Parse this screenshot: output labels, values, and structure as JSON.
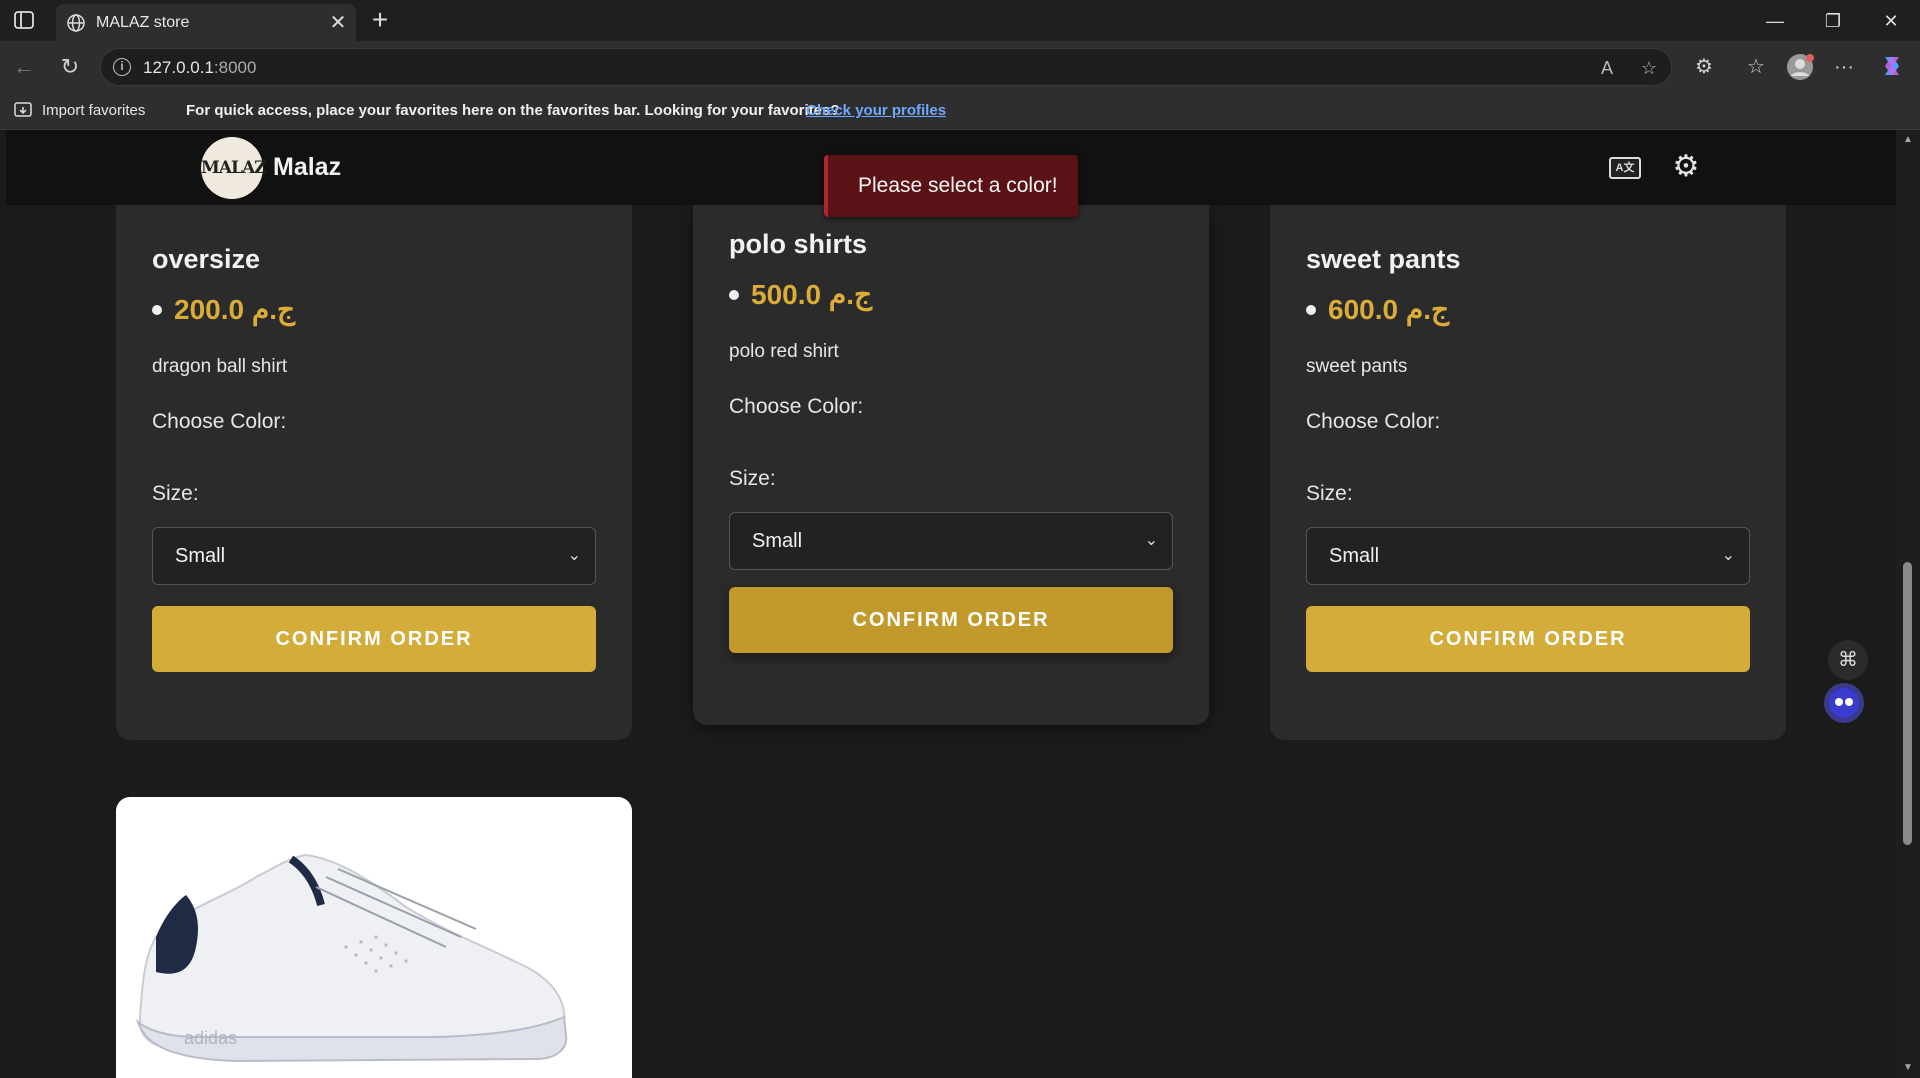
{
  "browser": {
    "tab_title": "MALAZ store",
    "url_host": "127.0.0.1",
    "url_port": ":8000",
    "favorites_import": "Import favorites",
    "favorites_message": "For quick access, place your favorites here on the favorites bar. Looking for your favorites?",
    "favorites_link": "Check your profiles"
  },
  "site": {
    "brand": "Malaz",
    "logo_text": "MALAZ",
    "toast": "Please select a color!"
  },
  "products": [
    {
      "name": "oversize",
      "price": "200.0 ج.م",
      "description": "dragon ball shirt",
      "color_label": "Choose Color:",
      "size_label": "Size:",
      "size_value": "Small",
      "button": "CONFIRM ORDER"
    },
    {
      "name": "polo shirts",
      "price": "500.0 ج.م",
      "description": "polo red shirt",
      "color_label": "Choose Color:",
      "size_label": "Size:",
      "size_value": "Small",
      "button": "CONFIRM ORDER"
    },
    {
      "name": "sweet pants",
      "price": "600.0 ج.م",
      "description": "sweet pants",
      "color_label": "Choose Color:",
      "size_label": "Size:",
      "size_value": "Small",
      "button": "CONFIRM ORDER"
    }
  ],
  "shoe": {
    "brand_mark": "adidas"
  },
  "colors": {
    "accent": "#d3ac3a",
    "price": "#dcac38",
    "toast_bg": "#5a1216",
    "page_bg": "#1b1b1b",
    "card_bg": "#2b2b2b"
  }
}
